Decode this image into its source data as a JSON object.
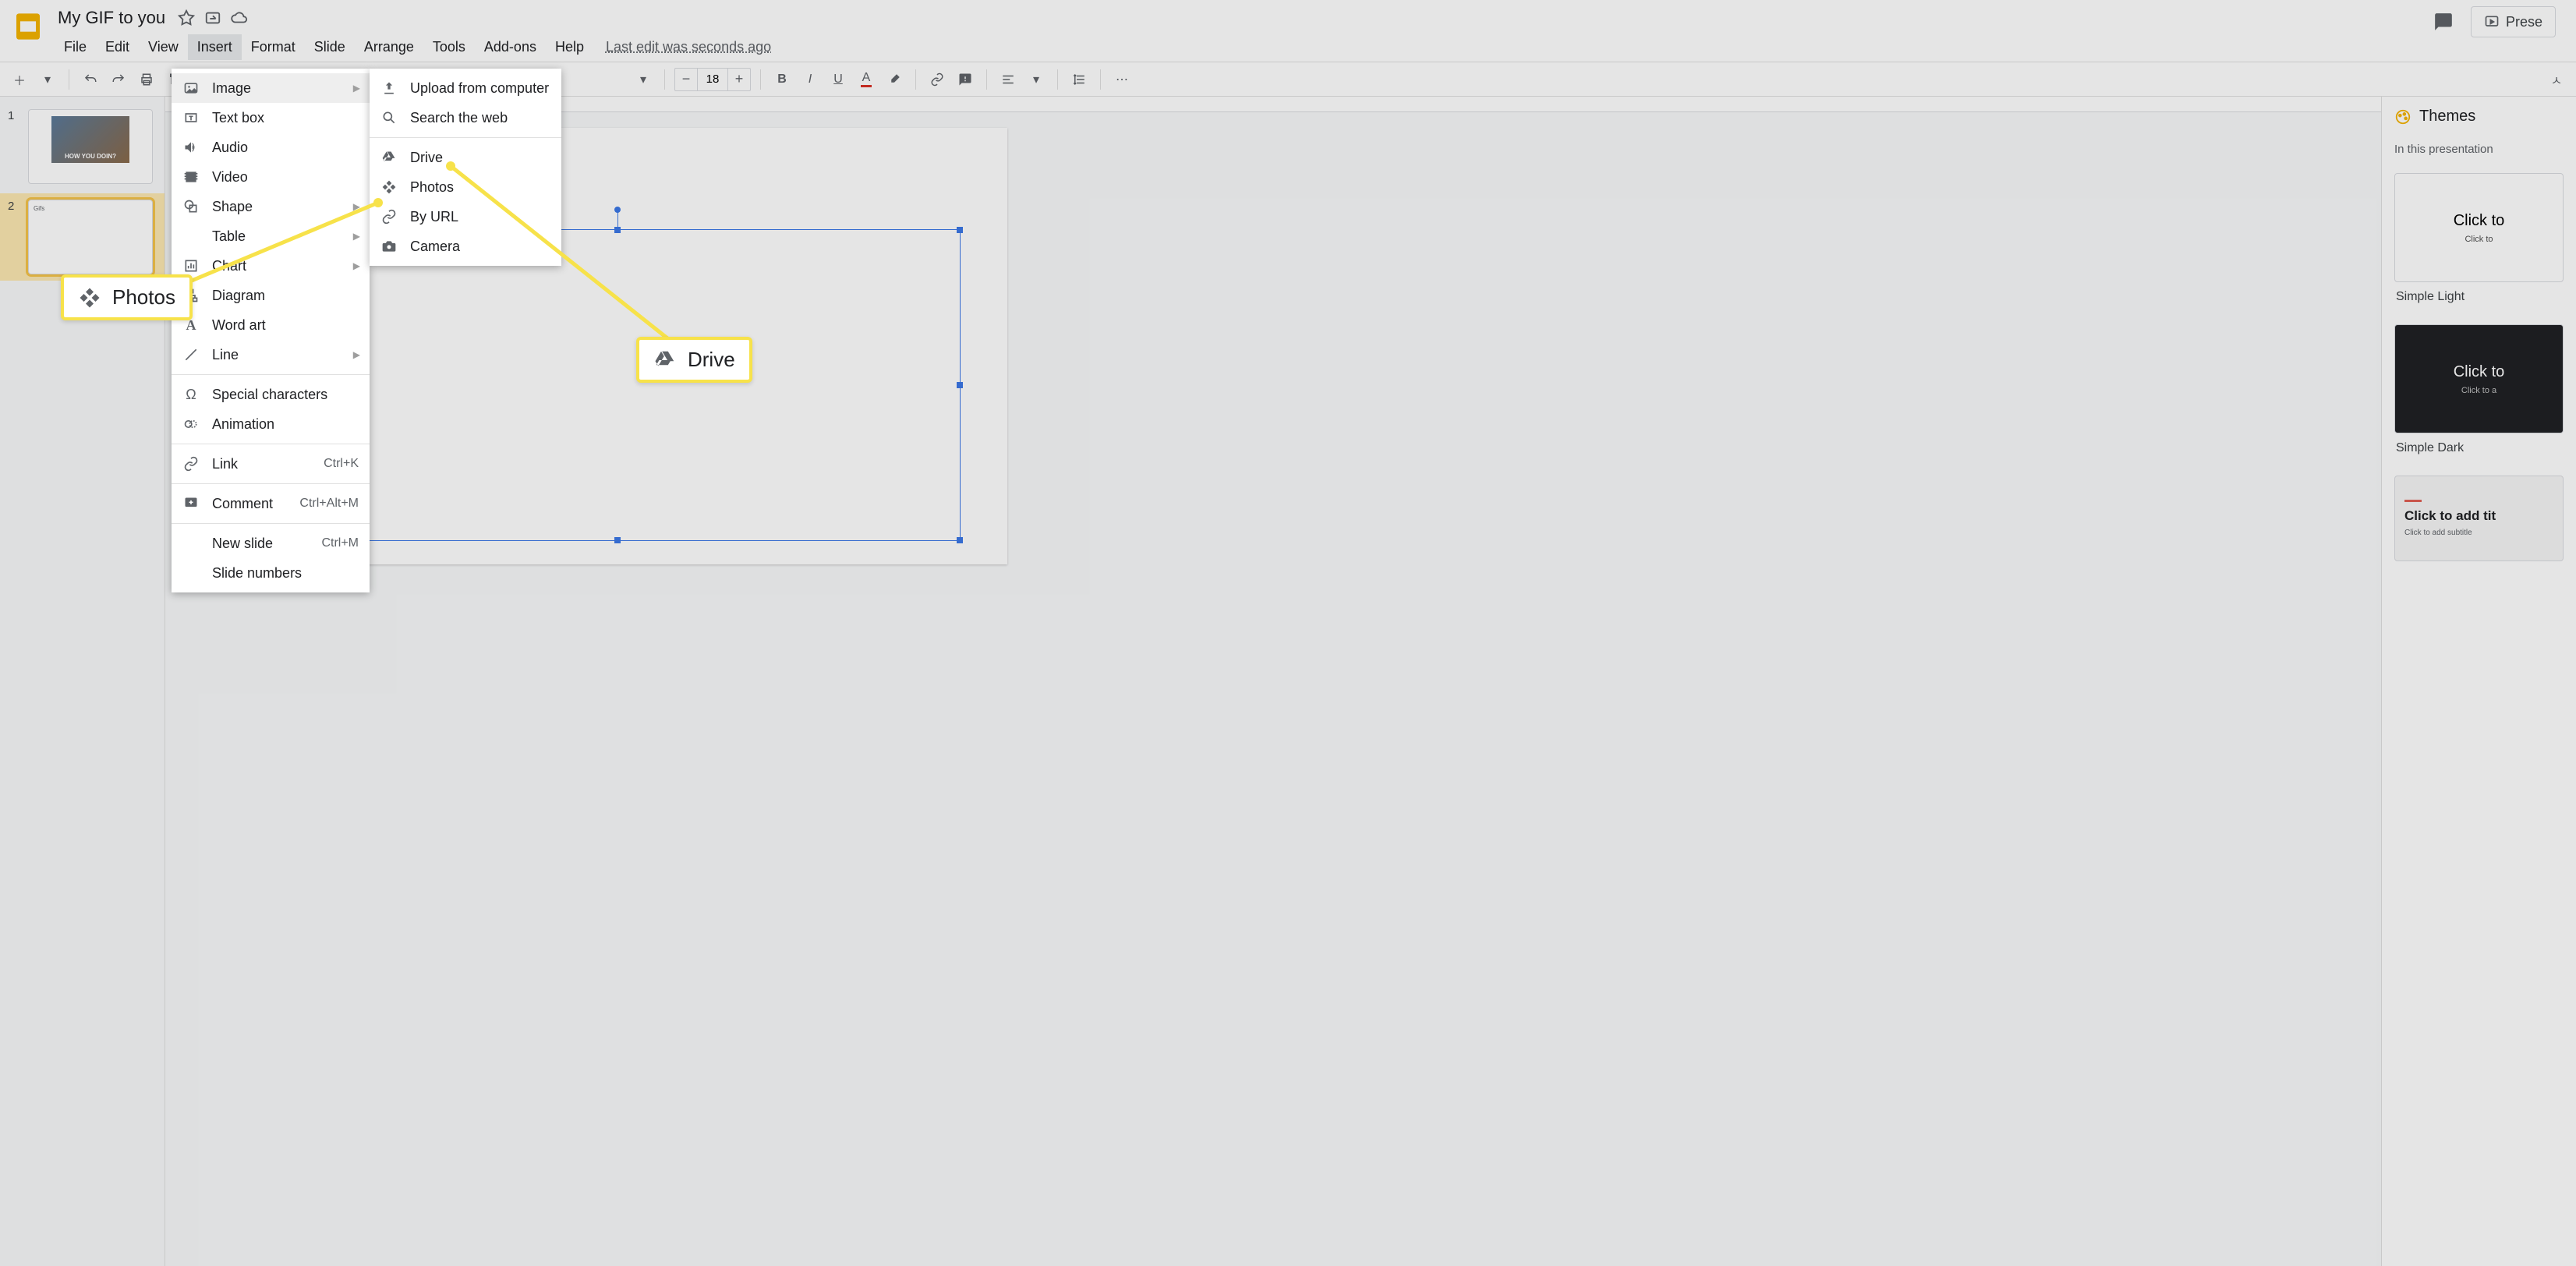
{
  "doc": {
    "title": "My GIF to you",
    "last_edit": "Last edit was seconds ago"
  },
  "menus": {
    "file": "File",
    "edit": "Edit",
    "view": "View",
    "insert": "Insert",
    "format": "Format",
    "slide": "Slide",
    "arrange": "Arrange",
    "tools": "Tools",
    "addons": "Add-ons",
    "help": "Help"
  },
  "present_btn": "Prese",
  "toolbar": {
    "font_size": "18"
  },
  "insert_menu": {
    "image": "Image",
    "textbox": "Text box",
    "audio": "Audio",
    "video": "Video",
    "shape": "Shape",
    "table": "Table",
    "chart": "Chart",
    "diagram": "Diagram",
    "wordart": "Word art",
    "line": "Line",
    "special": "Special characters",
    "animation": "Animation",
    "link": "Link",
    "link_kbd": "Ctrl+K",
    "comment": "Comment",
    "comment_kbd": "Ctrl+Alt+M",
    "newslide": "New slide",
    "newslide_kbd": "Ctrl+M",
    "slidenumbers": "Slide numbers"
  },
  "image_submenu": {
    "upload": "Upload from computer",
    "search": "Search the web",
    "drive": "Drive",
    "photos": "Photos",
    "byurl": "By URL",
    "camera": "Camera"
  },
  "themes": {
    "header": "Themes",
    "sub": "In this presentation",
    "light": {
      "title": "Click to",
      "sub": "Click to",
      "name": "Simple Light"
    },
    "dark": {
      "title": "Click to",
      "sub": "Click to a",
      "name": "Simple Dark"
    },
    "third": {
      "title": "Click to add tit",
      "sub": "Click to add subtitle"
    }
  },
  "filmstrip": {
    "n1": "1",
    "n2": "2",
    "thumb1_caption": "HOW YOU DOIN?",
    "thumb2_text": "Gifs"
  },
  "callouts": {
    "photos": "Photos",
    "drive": "Drive"
  }
}
